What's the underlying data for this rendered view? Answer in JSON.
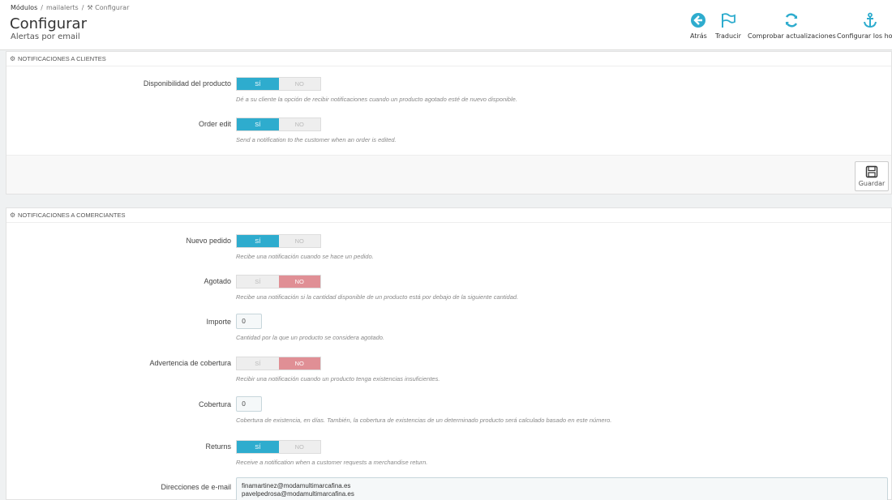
{
  "breadcrumb": {
    "item1": "Módulos",
    "item2": "mailalerts",
    "item3": "Configurar"
  },
  "header": {
    "title": "Configurar",
    "subtitle": "Alertas por email"
  },
  "toolbar": {
    "back": "Atrás",
    "translate": "Traducir",
    "check_updates": "Comprobar actualizaciones",
    "hooks": "Configurar los hooks"
  },
  "colors": {
    "accent": "#2eacce",
    "no_active": "#e08f95"
  },
  "customers_panel": {
    "title": "NOTIFICACIONES A CLIENTES",
    "fields": [
      {
        "label": "Disponibilidad del producto",
        "yes": "SÍ",
        "no": "NO",
        "value": "yes",
        "help": "Dé a su cliente la opción de recibir notificaciones cuando un producto agotado esté de nuevo disponible."
      },
      {
        "label": "Order edit",
        "yes": "SÍ",
        "no": "NO",
        "value": "yes",
        "help": "Send a notification to the customer when an order is edited."
      }
    ],
    "save": "Guardar"
  },
  "merchants_panel": {
    "title": "NOTIFICACIONES A COMERCIANTES",
    "fields": [
      {
        "label": "Nuevo pedido",
        "yes": "SÍ",
        "no": "NO",
        "value": "yes",
        "help": "Recibe una notificación cuando se hace un pedido."
      },
      {
        "label": "Agotado",
        "yes": "SÍ",
        "no": "NO",
        "value": "no",
        "help": "Recibe una notificación si la cantidad disponible de un producto está por debajo de la siguiente cantidad."
      },
      {
        "label": "Importe",
        "input": "0",
        "help": "Cantidad por la que un producto se considera agotado."
      },
      {
        "label": "Advertencia de cobertura",
        "yes": "SÍ",
        "no": "NO",
        "value": "no",
        "help": "Recibir una notificación cuando un producto tenga existencias insuficientes."
      },
      {
        "label": "Cobertura",
        "input": "0",
        "help": "Cobertura de existencia, en días. También, la cobertura de existencias de un determinado producto será calculado basado en este número."
      },
      {
        "label": "Returns",
        "yes": "SÍ",
        "no": "NO",
        "value": "yes",
        "help": "Receive a notification when a customer requests a merchandise return."
      },
      {
        "label": "Direcciones de e-mail",
        "emails": [
          "finamartinez@modamultimarcafina.es",
          "pavelpedrosa@modamultimarcafina.es"
        ]
      }
    ]
  }
}
